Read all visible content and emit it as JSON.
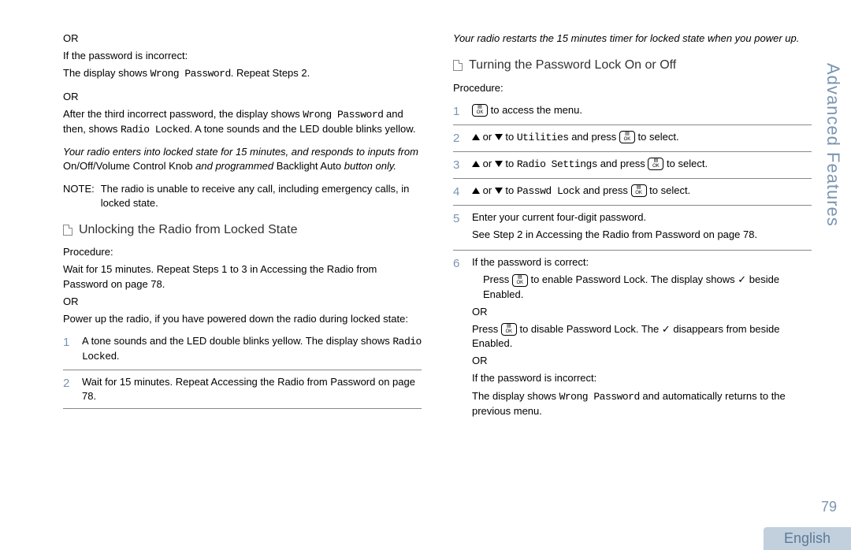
{
  "sidebar": {
    "title": "Advanced Features"
  },
  "page_number": "79",
  "language": "English",
  "left": {
    "or1": "OR",
    "p1a": "If the password is incorrect:",
    "p1b_pre": "The display shows ",
    "p1b_mono": "Wrong Password",
    "p1b_post": ". Repeat Steps 2.",
    "or2": "OR",
    "p2a_pre": "After the third incorrect password, the display shows ",
    "p2a_mono1": "Wrong Password",
    "p2a_mid": " and then, shows ",
    "p2a_mono2": "Radio Locked",
    "p2a_post": ". A tone sounds and the LED double blinks yellow.",
    "italic1_a": "Your radio enters into locked state for 15 minutes, and responds to inputs from ",
    "italic1_b": "On/Off/Volume Control Knob",
    "italic1_c": " and programmed ",
    "italic1_d": "Backlight Auto",
    "italic1_e": " button only.",
    "note_label": "NOTE:",
    "note_body": "The radio is unable to receive any call, including emergency calls, in locked state.",
    "section1": "Unlocking the Radio from Locked State",
    "procedure": "Procedure:",
    "proc1": "Wait for 15 minutes. Repeat Steps 1 to 3 in Accessing the Radio from Password  on page 78.",
    "or3": "OR",
    "proc2": "Power up the radio, if you have powered down the radio during locked state:",
    "step1_a": "A tone sounds and the LED double blinks yellow. The display shows ",
    "step1_mono": "Radio Locked",
    "step1_b": ".",
    "step2": "Wait for 15 minutes. Repeat Accessing the Radio from Password  on page 78."
  },
  "right": {
    "italic_top": "Your radio restarts the 15 minutes timer for locked state when you power up.",
    "section2": "Turning the Password Lock On or Off",
    "procedure": "Procedure:",
    "s1_post": " to access the menu.",
    "s2_or": " or ",
    "s2_to": " to ",
    "s2_mono": "Utilities",
    "s2_press": " and press ",
    "s2_sel": " to select.",
    "s3_mono": "Radio Settings",
    "s4_mono": "Passwd Lock",
    "s5a": "Enter your current four-digit password.",
    "s5b": "See Step 2 in Accessing the Radio from Password  on page 78.",
    "s6a": "If the password is correct:",
    "s6b_pre": "Press ",
    "s6b_post": " to enable Password Lock. The display shows ✓ beside Enabled.",
    "s6_or1": "OR",
    "s6c_pre": "Press ",
    "s6c_post": " to disable Password Lock. The ✓ disappears from beside Enabled.",
    "s6_or2": "OR",
    "s6d": "If the password is incorrect:",
    "s6e_pre": "The display shows ",
    "s6e_mono": "Wrong Password",
    "s6e_post": " and automatically returns to the previous menu."
  },
  "nums": {
    "n1": "1",
    "n2": "2",
    "n3": "3",
    "n4": "4",
    "n5": "5",
    "n6": "6"
  },
  "icons": {
    "ok_top": "▤",
    "ok_bot": "OK"
  }
}
